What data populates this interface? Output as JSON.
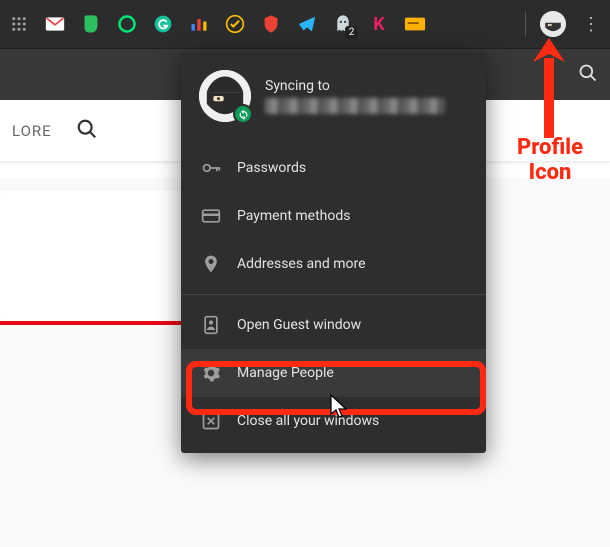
{
  "toolbar": {
    "extensions": [
      {
        "name": "apps-icon",
        "color": "#5f6368"
      },
      {
        "name": "gmail-icon",
        "color": "#ffffff"
      },
      {
        "name": "evernote-icon",
        "color": "#2dbe60"
      },
      {
        "name": "circle-icon",
        "color": "#00e676"
      },
      {
        "name": "grammarly-icon",
        "color": "#15c39a"
      },
      {
        "name": "chart-icon",
        "color": "#4285f4"
      },
      {
        "name": "check-icon",
        "color": "#fbbc04"
      },
      {
        "name": "shield-icon",
        "color": "#ea4335"
      },
      {
        "name": "paperplane-icon",
        "color": "#29b6f6"
      },
      {
        "name": "ghost-icon",
        "color": "#bdbdbd",
        "badge": "2"
      },
      {
        "name": "k-icon",
        "color": "#e91e63",
        "label": "K"
      },
      {
        "name": "card-icon",
        "color": "#ffb300"
      }
    ]
  },
  "nav": {
    "tab_label": "LORE"
  },
  "profile_menu": {
    "syncing_label": "Syncing to",
    "items_group1": [
      {
        "icon": "key-icon",
        "label": "Passwords"
      },
      {
        "icon": "card-icon",
        "label": "Payment methods"
      },
      {
        "icon": "pin-icon",
        "label": "Addresses and more"
      }
    ],
    "items_group2": [
      {
        "icon": "guest-icon",
        "label": "Open Guest window"
      },
      {
        "icon": "gear-icon",
        "label": "Manage People"
      },
      {
        "icon": "close-box-icon",
        "label": "Close all your windows"
      }
    ]
  },
  "annotation": {
    "profile_icon_line1": "Profile",
    "profile_icon_line2": "Icon"
  }
}
